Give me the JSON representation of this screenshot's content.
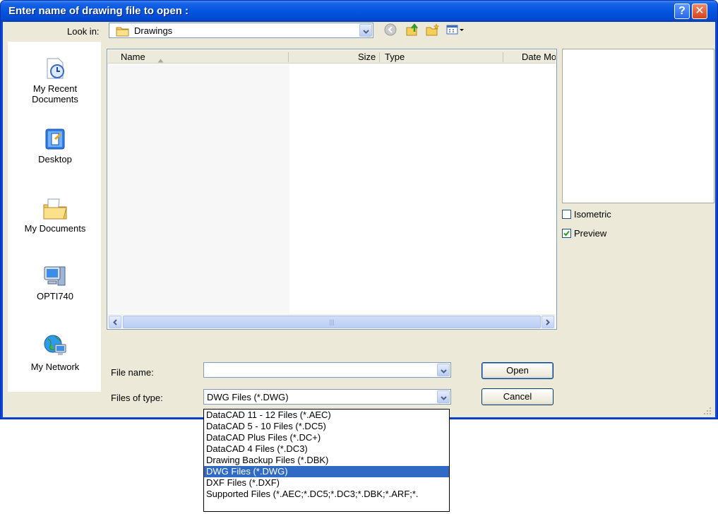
{
  "window": {
    "title": "Enter name of drawing file to open :",
    "help_glyph": "?",
    "close_glyph": "✕"
  },
  "lookin": {
    "label": "Look in:",
    "value": "Drawings"
  },
  "places": [
    {
      "label_line1": "My Recent",
      "label_line2": "Documents",
      "icon": "recent-documents-icon"
    },
    {
      "label_line1": "Desktop",
      "label_line2": "",
      "icon": "desktop-icon"
    },
    {
      "label_line1": "My Documents",
      "label_line2": "",
      "icon": "my-documents-icon"
    },
    {
      "label_line1": "OPTI740",
      "label_line2": "",
      "icon": "computer-icon"
    },
    {
      "label_line1": "My Network",
      "label_line2": "",
      "icon": "network-icon"
    }
  ],
  "filelist": {
    "columns": [
      "Name",
      "Size",
      "Type",
      "Date Mo"
    ]
  },
  "options": {
    "isometric_label": "Isometric",
    "isometric_checked": false,
    "preview_label": "Preview",
    "preview_checked": true
  },
  "file_name": {
    "label": "File name:",
    "value": ""
  },
  "file_type": {
    "label": "Files of type:",
    "value": "DWG Files (*.DWG)",
    "options": [
      "DataCAD 11 - 12 Files (*.AEC)",
      "DataCAD 5 - 10 Files (*.DC5)",
      "DataCAD Plus Files (*.DC+)",
      "DataCAD 4 Files (*.DC3)",
      "Drawing Backup Files (*.DBK)",
      "DWG Files (*.DWG)",
      "DXF Files (*.DXF)",
      "Supported Files (*.AEC;*.DC5;*.DC3;*.DBK;*.ARF;*."
    ],
    "selected_index": 5
  },
  "buttons": {
    "open": "Open",
    "cancel": "Cancel"
  },
  "colors": {
    "titlebar": "#0454e0",
    "selection": "#316ac5",
    "dialog_bg": "#ece9d8"
  }
}
